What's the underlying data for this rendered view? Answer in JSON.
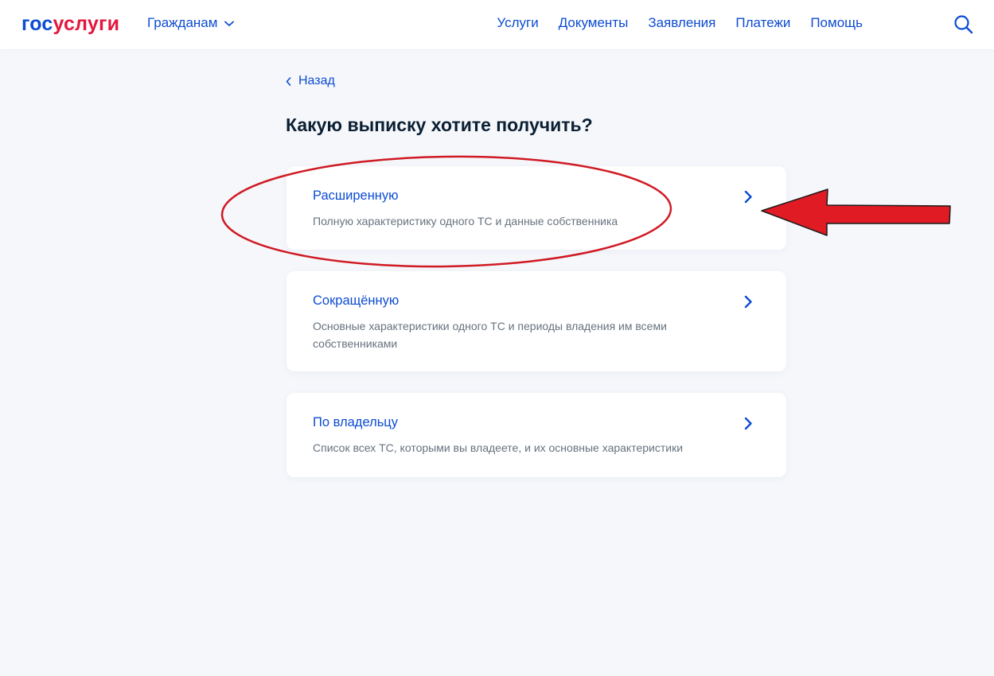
{
  "header": {
    "logo_part1": "гос",
    "logo_part2": "услуги",
    "audience_label": "Гражданам",
    "nav": [
      "Услуги",
      "Документы",
      "Заявления",
      "Платежи",
      "Помощь"
    ]
  },
  "page": {
    "back_label": "Назад",
    "title": "Какую выписку хотите получить?"
  },
  "options": [
    {
      "title": "Расширенную",
      "description": "Полную характеристику одного ТС и данные собственника"
    },
    {
      "title": "Сокращённую",
      "description": "Основные характеристики одного ТС и периоды владения им всеми собственниками"
    },
    {
      "title": "По владельцу",
      "description": "Список всех ТС, которыми вы владеете, и их основные характеристики"
    }
  ],
  "colors": {
    "brand_blue": "#0d4cd3",
    "brand_red": "#e3173e",
    "annotation_red": "#e01b24",
    "title_text": "#0b1f33",
    "desc_text": "#66727f",
    "background": "#f5f7fb"
  },
  "icons": [
    "chevron-down-icon",
    "search-icon",
    "chevron-left-icon",
    "chevron-right-icon"
  ]
}
